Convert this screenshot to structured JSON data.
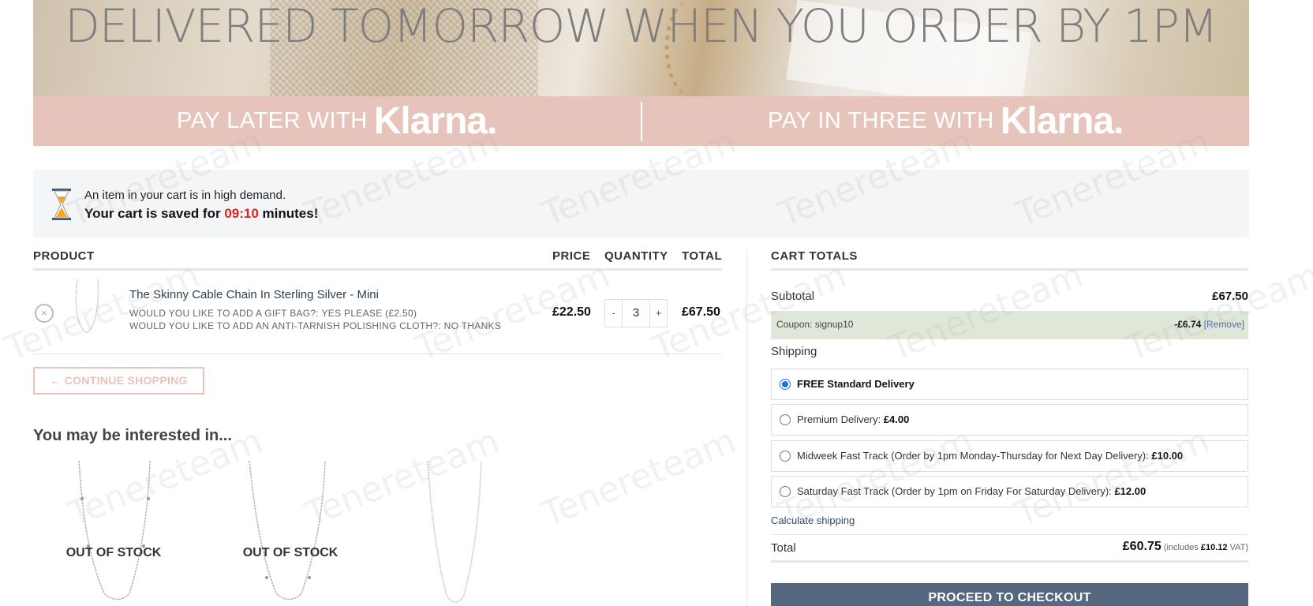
{
  "hero": {
    "headline": "DELIVERED TOMORROW WHEN YOU ORDER BY 1PM"
  },
  "klarna": {
    "left_text": "PAY LATER WITH",
    "right_text": "PAY IN THREE WITH",
    "brand": "Klarna."
  },
  "notice": {
    "line1": "An item in your cart is in high demand.",
    "line2_prefix": "Your cart is saved for ",
    "timer": "09:10",
    "line2_suffix": " minutes!"
  },
  "cart": {
    "headers": {
      "product": "PRODUCT",
      "price": "PRICE",
      "quantity": "QUANTITY",
      "total": "TOTAL"
    },
    "item": {
      "remove": "×",
      "name": "The Skinny Cable Chain In Sterling Silver - Mini",
      "meta1": "WOULD YOU LIKE TO ADD A GIFT BAG?: YES PLEASE (£2.50)",
      "meta2": "WOULD YOU LIKE TO ADD AN ANTI-TARNISH POLISHING CLOTH?: NO THANKS",
      "price": "£22.50",
      "qty_minus": "-",
      "qty": "3",
      "qty_plus": "+",
      "total": "£67.50"
    },
    "continue": "← CONTINUE SHOPPING"
  },
  "interest": {
    "title": "You may be interested in...",
    "items": [
      {
        "label": "OUT OF STOCK"
      },
      {
        "label": "OUT OF STOCK"
      },
      {
        "label": ""
      }
    ]
  },
  "totals": {
    "title": "CART TOTALS",
    "subtotal_label": "Subtotal",
    "subtotal": "£67.50",
    "coupon_label": "Coupon: signup10",
    "coupon_amount": "-£6.74",
    "coupon_remove": "[Remove]",
    "shipping_label": "Shipping",
    "shipping_options": [
      {
        "label": "FREE Standard Delivery",
        "price": "",
        "selected": true
      },
      {
        "label": "Premium Delivery:",
        "price": "£4.00",
        "selected": false
      },
      {
        "label": "Midweek Fast Track (Order by 1pm Monday-Thursday for Next Day Delivery):",
        "price": "£10.00",
        "selected": false
      },
      {
        "label": "Saturday Fast Track (Order by 1pm on Friday For Saturday Delivery):",
        "price": "£12.00",
        "selected": false
      }
    ],
    "calculate": "Calculate shipping",
    "total_label": "Total",
    "total": "£60.75",
    "vat_prefix": "(includes ",
    "vat": "£10.12",
    "vat_suffix": " VAT)",
    "checkout": "PROCEED TO CHECKOUT"
  },
  "watermark": "Tenereteam",
  "colors": {
    "accent": "#e6c4bb",
    "timer": "#e02020",
    "checkout": "#55687f",
    "coupon_bg": "#dfe8d8"
  }
}
